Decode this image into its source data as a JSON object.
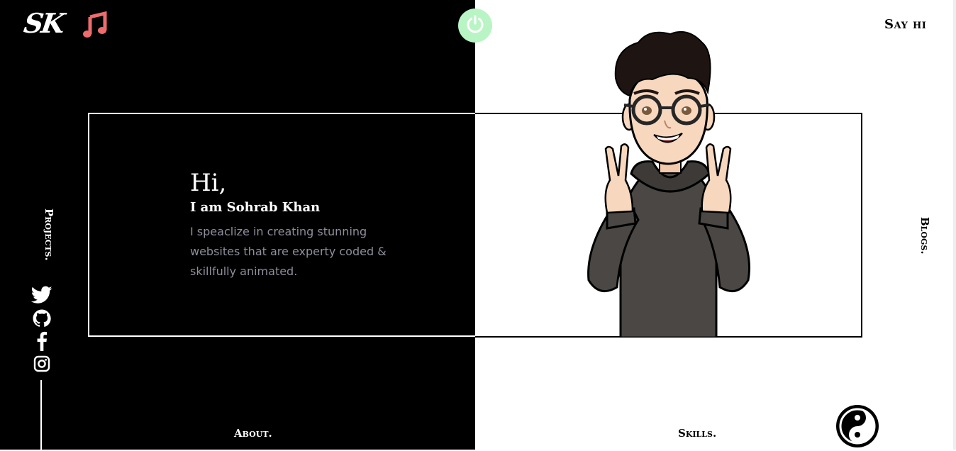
{
  "header": {
    "logo_text": "SK",
    "say_hi_label": "Say hi"
  },
  "nav": {
    "projects_label": "Projects.",
    "blogs_label": "Blogs.",
    "about_label": "About.",
    "skills_label": "Skills."
  },
  "intro": {
    "greeting": "Hi,",
    "name_line": "I am Sohrab Khan",
    "description": "I speaclize in creating stunning websites that are experty coded & skillfully animated."
  },
  "social_icons": [
    "twitter-icon",
    "github-icon",
    "facebook-icon",
    "instagram-icon"
  ],
  "icons": {
    "music": "music-note-icon",
    "power": "power-icon",
    "theme": "yin-yang-icon"
  },
  "colors": {
    "left_bg": "#000000",
    "right_bg": "#ffffff",
    "music_icon": "#ee6b6e",
    "power_button": "#b9f5c4",
    "description_text": "#8e8e9c"
  }
}
